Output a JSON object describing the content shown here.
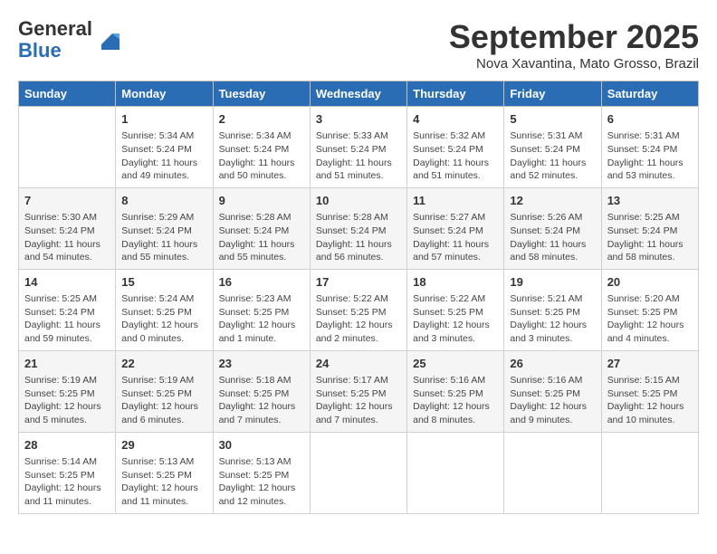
{
  "logo": {
    "general": "General",
    "blue": "Blue"
  },
  "header": {
    "month": "September 2025",
    "location": "Nova Xavantina, Mato Grosso, Brazil"
  },
  "weekdays": [
    "Sunday",
    "Monday",
    "Tuesday",
    "Wednesday",
    "Thursday",
    "Friday",
    "Saturday"
  ],
  "weeks": [
    [
      {
        "day": "",
        "info": ""
      },
      {
        "day": "1",
        "info": "Sunrise: 5:34 AM\nSunset: 5:24 PM\nDaylight: 11 hours\nand 49 minutes."
      },
      {
        "day": "2",
        "info": "Sunrise: 5:34 AM\nSunset: 5:24 PM\nDaylight: 11 hours\nand 50 minutes."
      },
      {
        "day": "3",
        "info": "Sunrise: 5:33 AM\nSunset: 5:24 PM\nDaylight: 11 hours\nand 51 minutes."
      },
      {
        "day": "4",
        "info": "Sunrise: 5:32 AM\nSunset: 5:24 PM\nDaylight: 11 hours\nand 51 minutes."
      },
      {
        "day": "5",
        "info": "Sunrise: 5:31 AM\nSunset: 5:24 PM\nDaylight: 11 hours\nand 52 minutes."
      },
      {
        "day": "6",
        "info": "Sunrise: 5:31 AM\nSunset: 5:24 PM\nDaylight: 11 hours\nand 53 minutes."
      }
    ],
    [
      {
        "day": "7",
        "info": "Sunrise: 5:30 AM\nSunset: 5:24 PM\nDaylight: 11 hours\nand 54 minutes."
      },
      {
        "day": "8",
        "info": "Sunrise: 5:29 AM\nSunset: 5:24 PM\nDaylight: 11 hours\nand 55 minutes."
      },
      {
        "day": "9",
        "info": "Sunrise: 5:28 AM\nSunset: 5:24 PM\nDaylight: 11 hours\nand 55 minutes."
      },
      {
        "day": "10",
        "info": "Sunrise: 5:28 AM\nSunset: 5:24 PM\nDaylight: 11 hours\nand 56 minutes."
      },
      {
        "day": "11",
        "info": "Sunrise: 5:27 AM\nSunset: 5:24 PM\nDaylight: 11 hours\nand 57 minutes."
      },
      {
        "day": "12",
        "info": "Sunrise: 5:26 AM\nSunset: 5:24 PM\nDaylight: 11 hours\nand 58 minutes."
      },
      {
        "day": "13",
        "info": "Sunrise: 5:25 AM\nSunset: 5:24 PM\nDaylight: 11 hours\nand 58 minutes."
      }
    ],
    [
      {
        "day": "14",
        "info": "Sunrise: 5:25 AM\nSunset: 5:24 PM\nDaylight: 11 hours\nand 59 minutes."
      },
      {
        "day": "15",
        "info": "Sunrise: 5:24 AM\nSunset: 5:25 PM\nDaylight: 12 hours\nand 0 minutes."
      },
      {
        "day": "16",
        "info": "Sunrise: 5:23 AM\nSunset: 5:25 PM\nDaylight: 12 hours\nand 1 minute."
      },
      {
        "day": "17",
        "info": "Sunrise: 5:22 AM\nSunset: 5:25 PM\nDaylight: 12 hours\nand 2 minutes."
      },
      {
        "day": "18",
        "info": "Sunrise: 5:22 AM\nSunset: 5:25 PM\nDaylight: 12 hours\nand 3 minutes."
      },
      {
        "day": "19",
        "info": "Sunrise: 5:21 AM\nSunset: 5:25 PM\nDaylight: 12 hours\nand 3 minutes."
      },
      {
        "day": "20",
        "info": "Sunrise: 5:20 AM\nSunset: 5:25 PM\nDaylight: 12 hours\nand 4 minutes."
      }
    ],
    [
      {
        "day": "21",
        "info": "Sunrise: 5:19 AM\nSunset: 5:25 PM\nDaylight: 12 hours\nand 5 minutes."
      },
      {
        "day": "22",
        "info": "Sunrise: 5:19 AM\nSunset: 5:25 PM\nDaylight: 12 hours\nand 6 minutes."
      },
      {
        "day": "23",
        "info": "Sunrise: 5:18 AM\nSunset: 5:25 PM\nDaylight: 12 hours\nand 7 minutes."
      },
      {
        "day": "24",
        "info": "Sunrise: 5:17 AM\nSunset: 5:25 PM\nDaylight: 12 hours\nand 7 minutes."
      },
      {
        "day": "25",
        "info": "Sunrise: 5:16 AM\nSunset: 5:25 PM\nDaylight: 12 hours\nand 8 minutes."
      },
      {
        "day": "26",
        "info": "Sunrise: 5:16 AM\nSunset: 5:25 PM\nDaylight: 12 hours\nand 9 minutes."
      },
      {
        "day": "27",
        "info": "Sunrise: 5:15 AM\nSunset: 5:25 PM\nDaylight: 12 hours\nand 10 minutes."
      }
    ],
    [
      {
        "day": "28",
        "info": "Sunrise: 5:14 AM\nSunset: 5:25 PM\nDaylight: 12 hours\nand 11 minutes."
      },
      {
        "day": "29",
        "info": "Sunrise: 5:13 AM\nSunset: 5:25 PM\nDaylight: 12 hours\nand 11 minutes."
      },
      {
        "day": "30",
        "info": "Sunrise: 5:13 AM\nSunset: 5:25 PM\nDaylight: 12 hours\nand 12 minutes."
      },
      {
        "day": "",
        "info": ""
      },
      {
        "day": "",
        "info": ""
      },
      {
        "day": "",
        "info": ""
      },
      {
        "day": "",
        "info": ""
      }
    ]
  ]
}
